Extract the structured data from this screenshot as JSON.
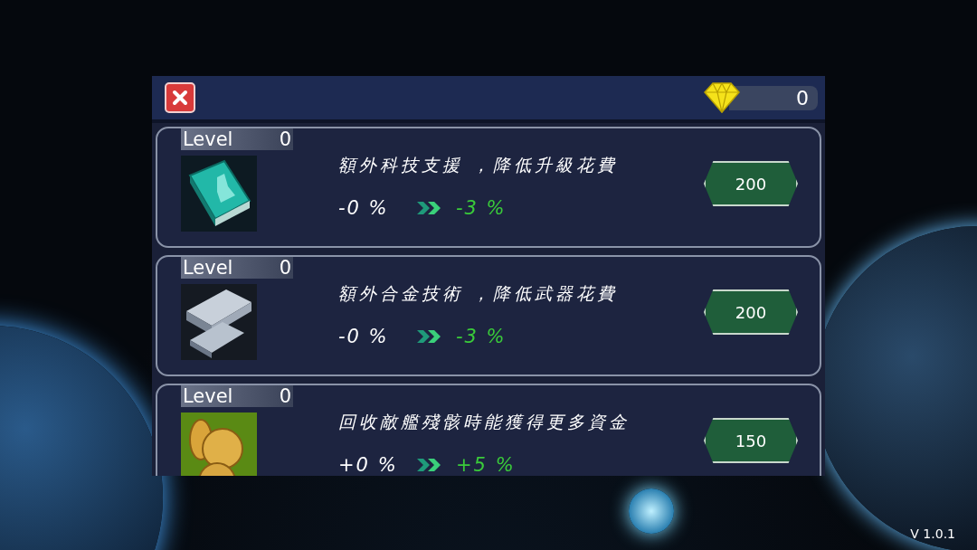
{
  "header": {
    "gems": "0"
  },
  "upgrades": [
    {
      "level_label": "Level",
      "level": "0",
      "description": "額外科技支援 ，降低升級花費",
      "current": "-0 %",
      "next": "-3 %",
      "price": "200"
    },
    {
      "level_label": "Level",
      "level": "0",
      "description": "額外合金技術 ，降低武器花費",
      "current": "-0 %",
      "next": "-3 %",
      "price": "200"
    },
    {
      "level_label": "Level",
      "level": "0",
      "description": "回收敵艦殘骸時能獲得更多資金",
      "current": "+0 %",
      "next": "+5 %",
      "price": "150"
    }
  ],
  "version": "V 1.0.1"
}
